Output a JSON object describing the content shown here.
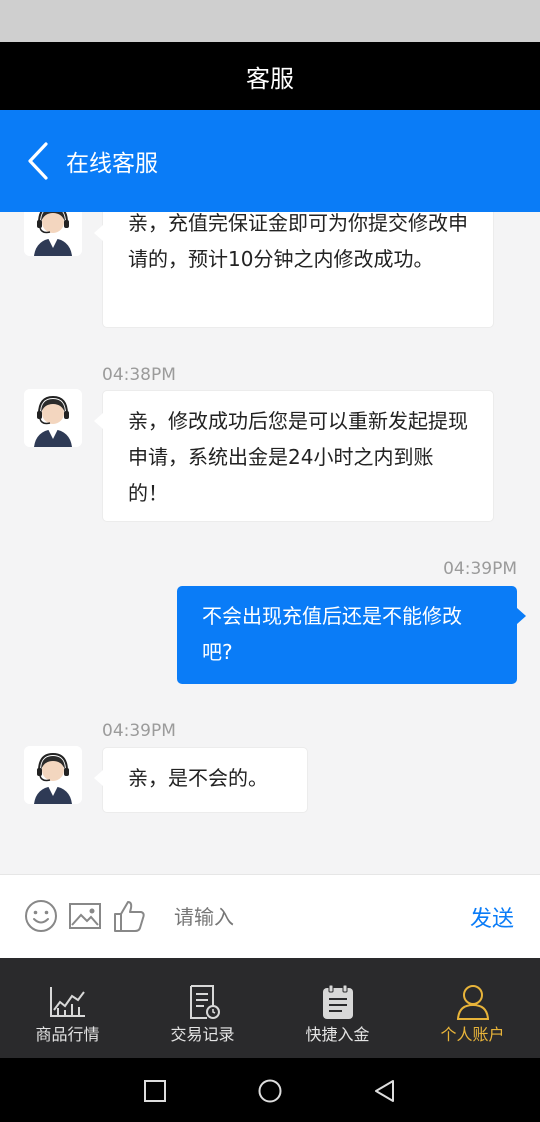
{
  "app": {
    "title": "客服"
  },
  "nav": {
    "title": "在线客服"
  },
  "messages": [
    {
      "side": "in",
      "time": "",
      "text": "亲，充值完保证金即可为你提交修改申请的，预计10分钟之内修改成功。"
    },
    {
      "side": "in",
      "time": "04:38PM",
      "text": "亲，修改成功后您是可以重新发起提现申请，系统出金是24小时之内到账的！"
    },
    {
      "side": "out",
      "time": "04:39PM",
      "text": "不会出现充值后还是不能修改吧?"
    },
    {
      "side": "in",
      "time": "04:39PM",
      "text": "亲，是不会的。"
    }
  ],
  "input": {
    "placeholder": "请输入",
    "value": "",
    "send_label": "发送"
  },
  "tabs": [
    {
      "label": "商品行情",
      "icon": "chart-icon"
    },
    {
      "label": "交易记录",
      "icon": "record-icon"
    },
    {
      "label": "快捷入金",
      "icon": "calendar-icon"
    },
    {
      "label": "个人账户",
      "icon": "user-icon",
      "active": true
    }
  ],
  "colors": {
    "brand_blue": "#0a7cf7",
    "active_tab": "#e8b43a",
    "tabbar_bg": "#2a2a2c"
  }
}
